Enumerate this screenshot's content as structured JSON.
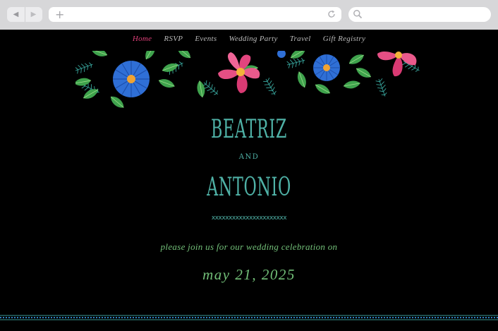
{
  "browser": {
    "back_icon": "back-arrow-icon",
    "forward_icon": "forward-arrow-icon",
    "new_tab_icon": "plus-icon",
    "reload_icon": "reload-icon",
    "search_icon": "search-icon",
    "url": ""
  },
  "nav": {
    "items": [
      {
        "label": "Home",
        "active": true
      },
      {
        "label": "RSVP",
        "active": false
      },
      {
        "label": "Events",
        "active": false
      },
      {
        "label": "Wedding Party",
        "active": false
      },
      {
        "label": "Travel",
        "active": false
      },
      {
        "label": "Gift Registry",
        "active": false
      }
    ],
    "active_color": "#e0407a",
    "color": "#b9b9b9"
  },
  "hero": {
    "name1": "BEATRIZ",
    "and": "AND",
    "name2": "ANTONIO",
    "divider": "xxxxxxxxxxxxxxxxxxxxxx",
    "invite": "please join us for our wedding celebration on",
    "date": "may 21, 2025"
  },
  "colors": {
    "background": "#000000",
    "teal": "#4fb1a6",
    "green": "#72bf78",
    "pink": "#e0407a",
    "blue": "#2f6fd6"
  }
}
